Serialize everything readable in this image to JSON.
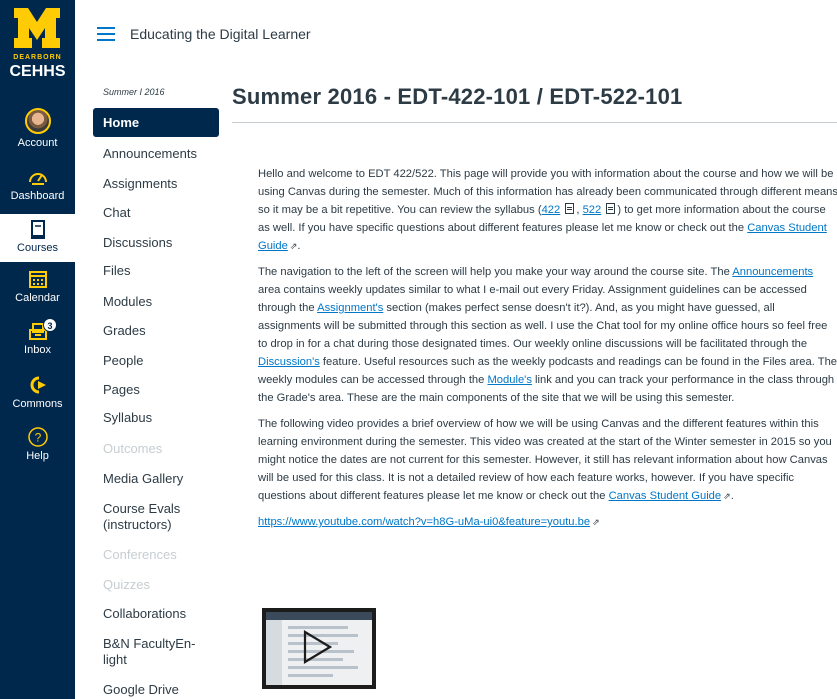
{
  "global_nav": {
    "logo_text": "M",
    "logo_sub1": "DEARBORN",
    "logo_sub2": "CEHHS",
    "items": [
      {
        "label": "Account",
        "icon": "avatar"
      },
      {
        "label": "Dashboard",
        "icon": "dashboard-icon"
      },
      {
        "label": "Courses",
        "icon": "courses-icon"
      },
      {
        "label": "Calendar",
        "icon": "calendar-icon"
      },
      {
        "label": "Inbox",
        "icon": "inbox-icon",
        "badge": "3"
      },
      {
        "label": "Commons",
        "icon": "commons-icon"
      },
      {
        "label": "Help",
        "icon": "help-icon"
      }
    ],
    "colors": {
      "bg": "#00274c",
      "accent": "#ffcb05"
    }
  },
  "header": {
    "breadcrumb": "Educating the Digital Learner"
  },
  "course_nav": {
    "term": "Summer I 2016",
    "items": [
      {
        "label": "Home",
        "state": "active"
      },
      {
        "label": "Announcements",
        "state": "normal"
      },
      {
        "label": "Assignments",
        "state": "normal"
      },
      {
        "label": "Chat",
        "state": "normal"
      },
      {
        "label": "Discussions",
        "state": "normal"
      },
      {
        "label": "Files",
        "state": "normal"
      },
      {
        "label": "Modules",
        "state": "normal"
      },
      {
        "label": "Grades",
        "state": "normal"
      },
      {
        "label": "People",
        "state": "normal"
      },
      {
        "label": "Pages",
        "state": "normal"
      },
      {
        "label": "Syllabus",
        "state": "normal"
      },
      {
        "label": "Outcomes",
        "state": "disabled"
      },
      {
        "label": "Media Gallery",
        "state": "normal"
      },
      {
        "label": "Course Evals (instructors)",
        "state": "normal"
      },
      {
        "label": "Conferences",
        "state": "disabled"
      },
      {
        "label": "Quizzes",
        "state": "disabled"
      },
      {
        "label": "Collaborations",
        "state": "normal"
      },
      {
        "label": "B&N FacultyEn-light",
        "state": "normal"
      },
      {
        "label": "Google Drive",
        "state": "normal"
      }
    ]
  },
  "main": {
    "title": "Summer 2016 - EDT-422-101 / EDT-522-101",
    "p1": {
      "t1": "Hello and welcome to EDT 422/522.  This page will provide you with information about the course and how we will be using Canvas during the semester.  Much of this information has already been communicated through different means so it may be a bit repetitive.  You can review the syllabus (",
      "l1": "422",
      "t2": ", ",
      "l2": "522",
      "t3": ") to get more information about the course as well.  If you have specific questions about different features please let me know or check out the ",
      "l3": "Canvas Student Guide",
      "t4": "."
    },
    "p2": {
      "t1": "The navigation to the left of the screen will help you make your way around the course site. The ",
      "l1": "Announcements",
      "t2": " area contains weekly updates similar to what I e-mail out every Friday.  Assignment guidelines can be accessed through the ",
      "l2": "Assignment's",
      "t3": " section (makes perfect sense doesn't it?).  And, as you might have guessed, all assignments will be submitted through this section as well.  I use the Chat tool for my online office hours so feel free to drop in for a chat during those designated times.  Our weekly online discussions will be facilitated through the ",
      "l3": "Discussion's",
      "t4": " feature.  Useful resources such as the weekly podcasts and readings can be found in the Files area.  The weekly modules can be accessed through the ",
      "l4": "Module's",
      "t5": " link and you can track your performance in the class through the Grade's area.  These are the main components of the site that we will be using this semester."
    },
    "p3": {
      "t1": "The following video provides a brief overview of how we will be using Canvas and the different features within this learning environment during the semester.  This video was created at the start of the Winter semester in 2015 so you might notice the dates are not current for this semester.  However, it still has relevant information about how Canvas will be used for this class.  It is not a detailed review of how each feature works, however.  If you have specific questions about different features please let me know or check out the ",
      "l1": "Canvas Student Guide",
      "t2": "."
    },
    "video_link": "https://www.youtube.com/watch?v=h8G-uMa-ui0&feature=youtu.be"
  }
}
